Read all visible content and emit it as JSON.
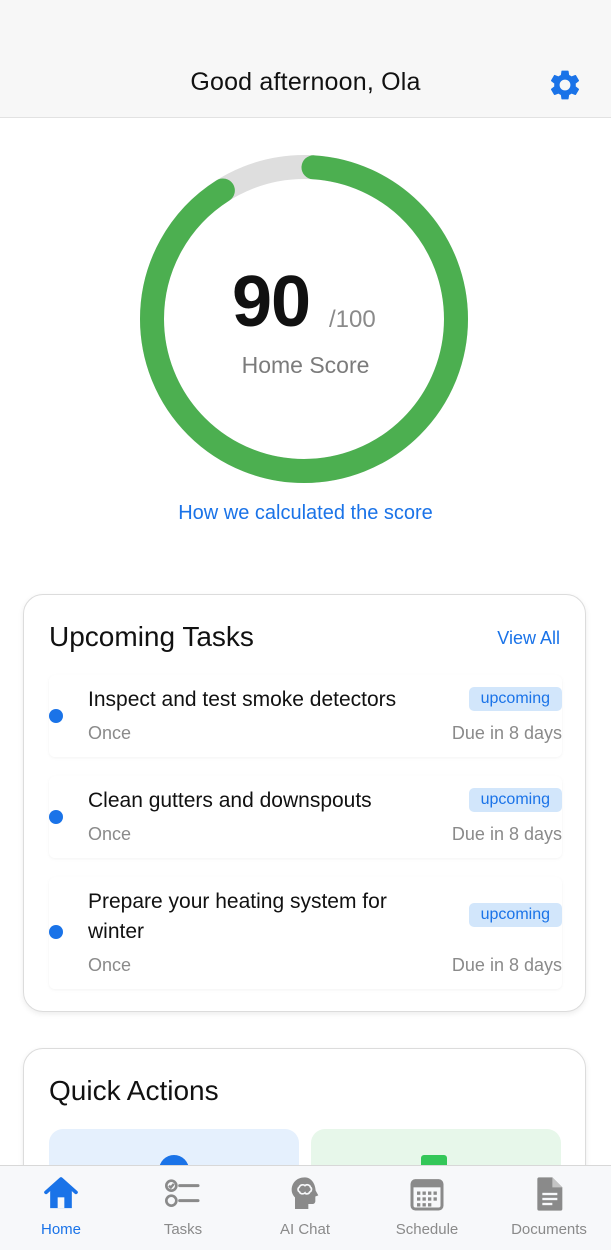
{
  "header": {
    "title": "Good afternoon, Ola",
    "settings_icon": "gear-icon"
  },
  "score": {
    "value": "90",
    "max": "/100",
    "label": "Home Score",
    "fraction": 0.9,
    "ring_color": "#4caf50",
    "track_color": "#dedede",
    "link": "How we calculated the score"
  },
  "tasks": {
    "title": "Upcoming Tasks",
    "view_all": "View All",
    "items": [
      {
        "title": "Inspect and test smoke detectors",
        "status": "upcoming",
        "frequency": "Once",
        "due": "Due in 8 days"
      },
      {
        "title": "Clean gutters and downspouts",
        "status": "upcoming",
        "frequency": "Once",
        "due": "Due in 8 days"
      },
      {
        "title": "Prepare your heating system for winter",
        "status": "upcoming",
        "frequency": "Once",
        "due": "Due in 8 days"
      }
    ]
  },
  "quick_actions": {
    "title": "Quick Actions"
  },
  "tabbar": {
    "tabs": [
      {
        "label": "Home",
        "icon": "house-icon",
        "active": true
      },
      {
        "label": "Tasks",
        "icon": "checklist-icon",
        "active": false
      },
      {
        "label": "AI Chat",
        "icon": "brain-head-icon",
        "active": false
      },
      {
        "label": "Schedule",
        "icon": "calendar-icon",
        "active": false
      },
      {
        "label": "Documents",
        "icon": "document-icon",
        "active": false
      }
    ]
  },
  "colors": {
    "accent": "#1a73e8",
    "score_green": "#4caf50",
    "badge_bg": "#d2e6fb"
  }
}
